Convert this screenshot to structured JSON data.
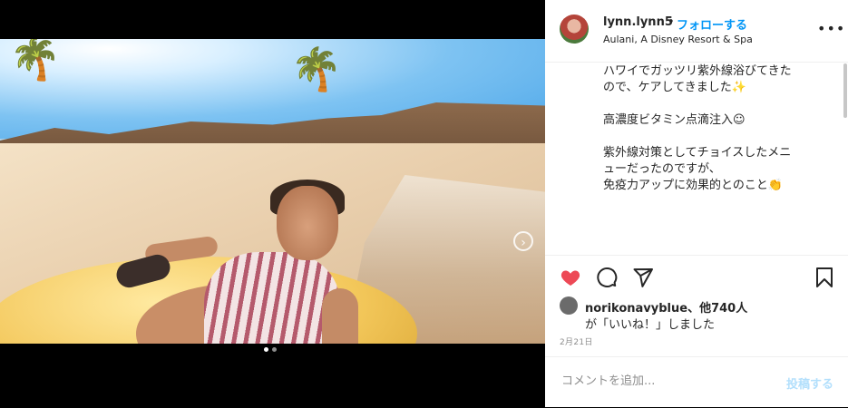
{
  "post": {
    "dots_total": 2,
    "dots_active": 1,
    "next_icon": "chevron-right-icon"
  },
  "header": {
    "username": "lynn.lynn5",
    "separator": "•",
    "follow_label": "フォローする",
    "location": "Aulani, A Disney Resort & Spa",
    "more_icon": "ellipsis-icon"
  },
  "caption": {
    "lines": [
      "ハワイでガッツリ紫外線浴びてきた",
      "ので、ケアしてきました✨",
      "",
      "高濃度ビタミン点滴注入☺",
      "",
      "紫外線対策としてチョイスしたメニ",
      "ューだったのですが、",
      "免疫力アップに効果的とのこと👏"
    ]
  },
  "actions": {
    "like_color": "#ed4956",
    "icons": [
      "heart-icon",
      "comment-icon",
      "share-icon",
      "bookmark-icon"
    ]
  },
  "likes": {
    "user": "norikonavyblue",
    "others": "、他740人",
    "suffix": "が「いいね！」しました"
  },
  "date": "2月21日",
  "comment": {
    "placeholder": "コメントを追加...",
    "post_label": "投稿する"
  },
  "colors": {
    "accent": "#0095f6",
    "post_disabled": "#b2dffc"
  }
}
